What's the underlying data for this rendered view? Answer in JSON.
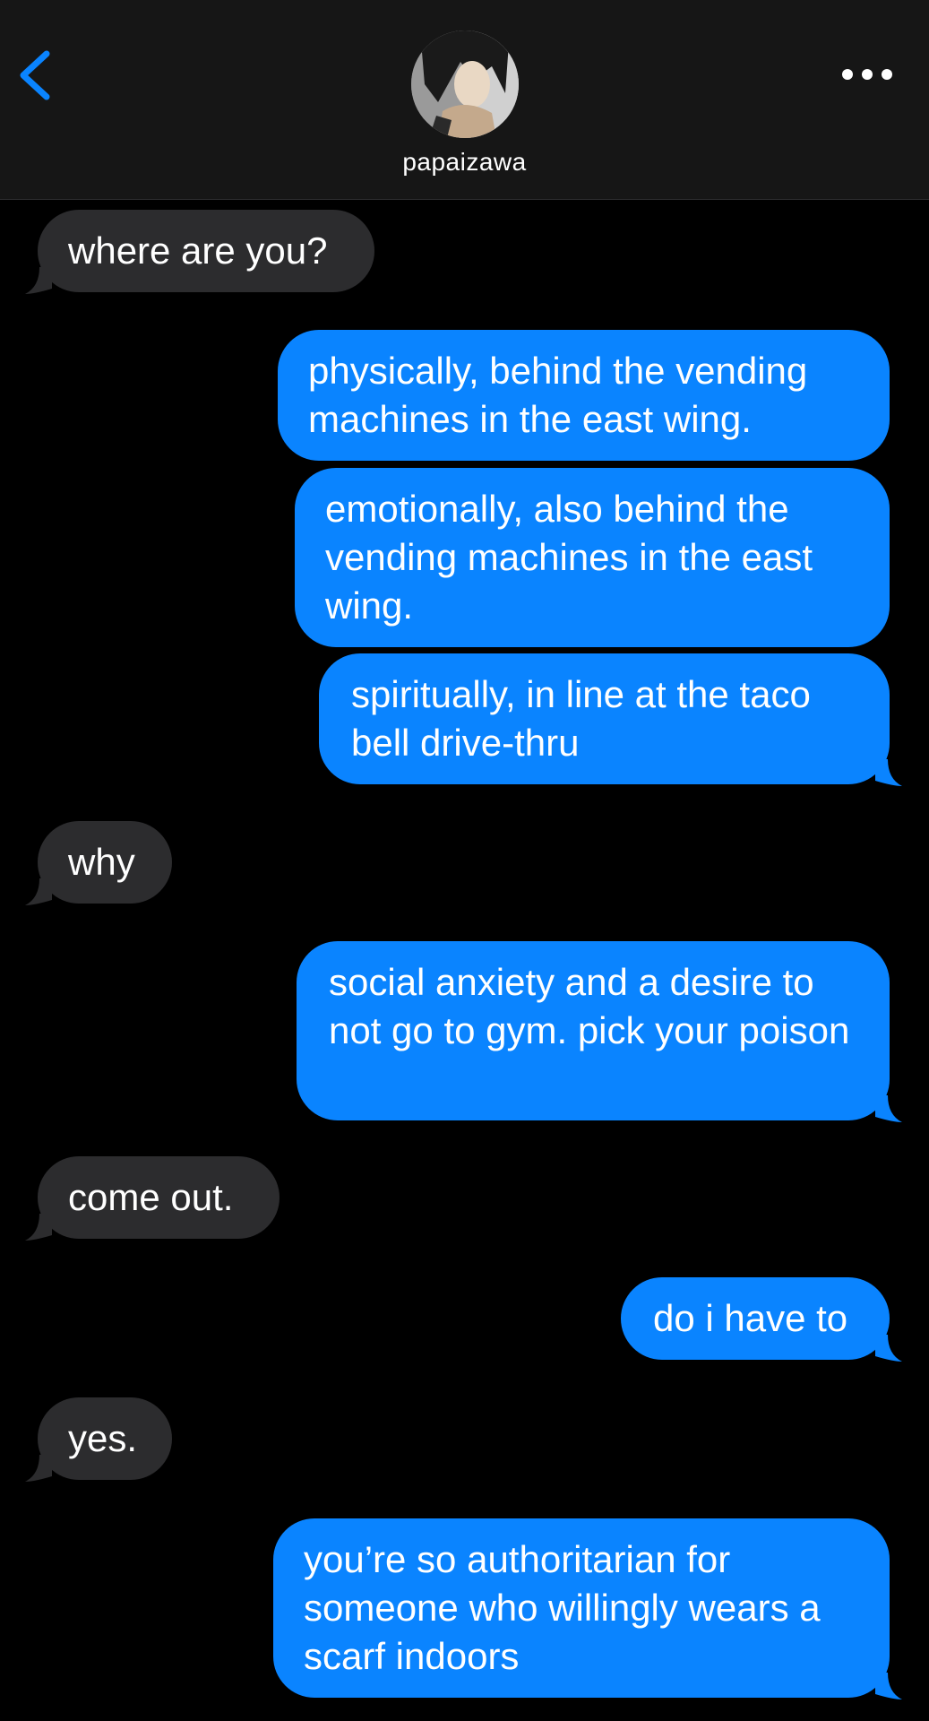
{
  "header": {
    "contact_name": "papaizawa",
    "back_icon": "chevron-left-icon",
    "more_icon": "ellipsis-icon",
    "accent": "#0a84ff"
  },
  "colors": {
    "sent_bubble": "#0a84ff",
    "received_bubble": "#2c2c2e",
    "background": "#000000",
    "header_bg": "#161616"
  },
  "messages": [
    {
      "from": "received",
      "text": "where are you?"
    },
    {
      "from": "sent",
      "text": "physically, behind the vending machines in the east wing."
    },
    {
      "from": "sent",
      "text": "emotionally, also behind the vending machines in the east wing."
    },
    {
      "from": "sent",
      "text": "spiritually, in line at the taco bell drive-thru"
    },
    {
      "from": "received",
      "text": "why"
    },
    {
      "from": "sent",
      "text": "social anxiety and a desire to not go to gym. pick your poison"
    },
    {
      "from": "received",
      "text": "come out."
    },
    {
      "from": "sent",
      "text": "do i have to"
    },
    {
      "from": "received",
      "text": "yes."
    },
    {
      "from": "sent",
      "text": "you’re so authoritarian for someone who willingly wears a scarf indoors"
    }
  ]
}
